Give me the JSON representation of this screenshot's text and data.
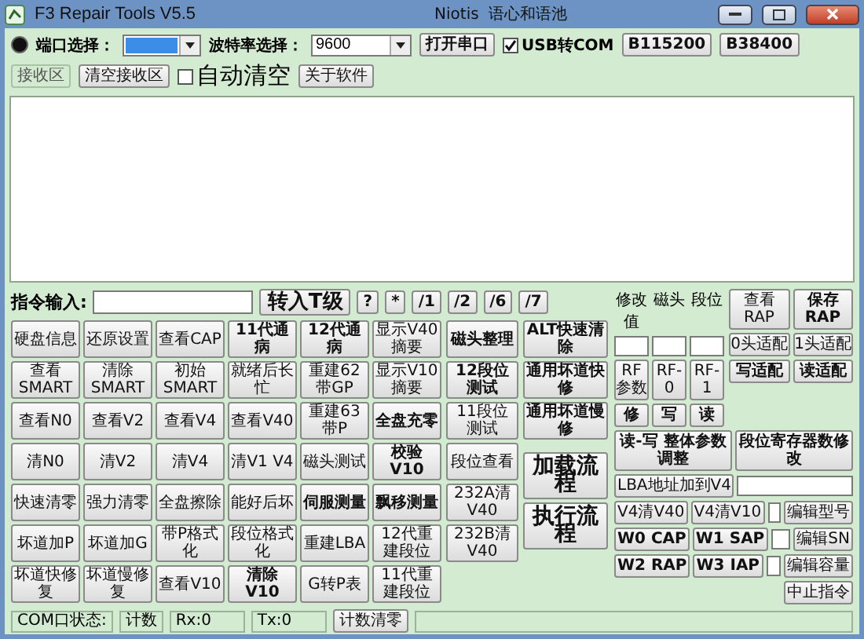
{
  "window": {
    "title": "F3 Repair Tools V5.5",
    "subtitle_1": "Niotis",
    "subtitle_2": "语心和语池"
  },
  "toolbar": {
    "port_label": "端口选择：",
    "baud_label": "波特率选择：",
    "baud_value": "9600",
    "open_button": "打开串口",
    "usb_com": {
      "label": "USB转COM",
      "checked": true
    },
    "baud_buttons": [
      "B115200",
      "B38400"
    ],
    "receive_label": "接收区",
    "clear_button": "清空接收区",
    "auto_clear": {
      "label": "自动清空",
      "checked": false
    },
    "about_button": "关于软件"
  },
  "command": {
    "label": "指令输入:",
    "submit": "转入T级",
    "small_buttons": [
      "?",
      "*",
      "/1",
      "/2",
      "/6",
      "/7"
    ]
  },
  "grid": [
    [
      {
        "label": "硬盘信息",
        "bold": false
      },
      {
        "label": "还原设置",
        "bold": false
      },
      {
        "label": "查看CAP",
        "bold": false
      },
      {
        "label": "11代通病",
        "bold": true
      },
      {
        "label": "12代通病",
        "bold": true
      },
      {
        "label": "显示V40摘要",
        "bold": false
      }
    ],
    [
      {
        "label": "查看SMART",
        "bold": false
      },
      {
        "label": "清除SMART",
        "bold": false
      },
      {
        "label": "初始SMART",
        "bold": false
      },
      {
        "label": "就绪后长忙",
        "bold": false
      },
      {
        "label": "重建62带GP",
        "bold": false
      },
      {
        "label": "显示V10摘要",
        "bold": false
      }
    ],
    [
      {
        "label": "查看N0",
        "bold": false
      },
      {
        "label": "查看V2",
        "bold": false
      },
      {
        "label": "查看V4",
        "bold": false
      },
      {
        "label": "查看V40",
        "bold": false
      },
      {
        "label": "重建63带P",
        "bold": false
      },
      {
        "label": "全盘充零",
        "bold": true
      }
    ],
    [
      {
        "label": "清N0",
        "bold": false
      },
      {
        "label": "清V2",
        "bold": false
      },
      {
        "label": "清V4",
        "bold": false
      },
      {
        "label": "清V1 V4",
        "bold": false
      },
      {
        "label": "磁头测试",
        "bold": false
      },
      {
        "label": "校验V10",
        "bold": true
      }
    ],
    [
      {
        "label": "快速清零",
        "bold": false
      },
      {
        "label": "强力清零",
        "bold": false
      },
      {
        "label": "全盘擦除",
        "bold": false
      },
      {
        "label": "能好后坏",
        "bold": false
      },
      {
        "label": "伺服测量",
        "bold": true
      },
      {
        "label": "飘移测量",
        "bold": true
      }
    ],
    [
      {
        "label": "坏道加P",
        "bold": false
      },
      {
        "label": "坏道加G",
        "bold": false
      },
      {
        "label": "带P格式化",
        "bold": false
      },
      {
        "label": "段位格式化",
        "bold": false
      },
      {
        "label": "重建LBA",
        "bold": false
      },
      {
        "label": "12代重建段位",
        "bold": false
      }
    ],
    [
      {
        "label": "坏道快修复",
        "bold": false
      },
      {
        "label": "坏道慢修复",
        "bold": false
      },
      {
        "label": "查看V10",
        "bold": false
      },
      {
        "label": "清除V10",
        "bold": true
      },
      {
        "label": "G转P表",
        "bold": false
      },
      {
        "label": "11代重建段位",
        "bold": false
      }
    ]
  ],
  "column_b": [
    {
      "label": "磁头整理",
      "bold": true
    },
    {
      "label": "12段位测试",
      "bold": true
    },
    {
      "label": "11段位测试",
      "bold": false
    },
    {
      "label": "段位查看",
      "bold": false
    },
    {
      "label": "232A清V40",
      "bold": false
    },
    {
      "label": "232B清V40",
      "bold": false
    }
  ],
  "column_c": [
    {
      "label": "ALT快速清除",
      "bold": true
    },
    {
      "label": "通用坏道快修",
      "bold": true
    },
    {
      "label": "通用坏道慢修",
      "bold": true
    }
  ],
  "flow_buttons": [
    "加载流程",
    "执行流程"
  ],
  "params": {
    "headers": [
      "修改值",
      "磁头",
      "段位"
    ],
    "rf": [
      "RF参数",
      "RF-0",
      "RF-1"
    ],
    "rw": [
      "修",
      "写",
      "读"
    ],
    "adjust": "读-写 整体参数调整",
    "lba": "LBA地址加到V4",
    "pairs": [
      [
        "V4清V40",
        "V4清V10"
      ],
      [
        "W0 CAP",
        "W1 SAP"
      ],
      [
        "W2 RAP",
        "W3 IAP"
      ]
    ]
  },
  "right": {
    "pairs": [
      [
        "查看RAP",
        "保存RAP"
      ],
      [
        "0头适配",
        "1头适配"
      ],
      [
        "写适配",
        "读适配"
      ]
    ],
    "register": "段位寄存器数修改",
    "edits": [
      "编辑型号",
      "编辑SN",
      "编辑容量"
    ],
    "stop": "中止指令"
  },
  "status_bar": {
    "com_label": "COM口状态:",
    "count_label": "计数",
    "rx": "Rx:0",
    "tx": "Tx:0",
    "reset": "计数清零"
  }
}
